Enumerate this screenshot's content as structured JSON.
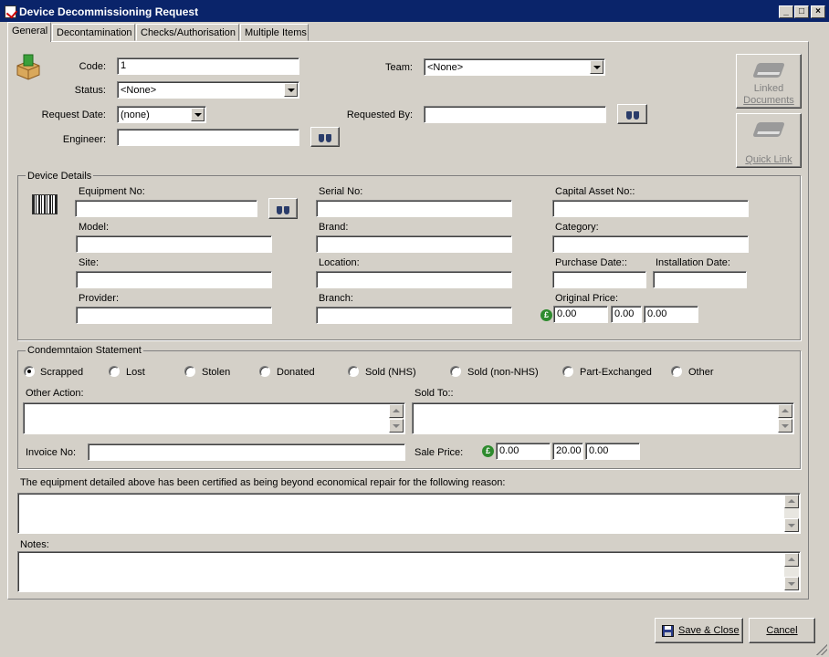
{
  "window": {
    "title": "Device Decommissioning Request"
  },
  "tabs": [
    {
      "label": "General"
    },
    {
      "label": "Decontamination"
    },
    {
      "label": "Checks/Authorisation"
    },
    {
      "label": "Multiple Items"
    }
  ],
  "header": {
    "code_label": "Code:",
    "code_value": "1",
    "status_label": "Status:",
    "status_value": "<None>",
    "request_date_label": "Request Date:",
    "request_date_value": "(none)",
    "engineer_label": "Engineer:",
    "engineer_value": "",
    "team_label": "Team:",
    "team_value": "<None>",
    "requested_by_label": "Requested By:",
    "requested_by_value": ""
  },
  "side_buttons": {
    "linked_documents_line1": "Linked",
    "linked_documents_line2": "Documents",
    "quick_link": "Quick Link"
  },
  "device_details": {
    "title": "Device Details",
    "equipment_no_label": "Equipment No:",
    "serial_no_label": "Serial No:",
    "capital_asset_no_label": "Capital Asset No::",
    "model_label": "Model:",
    "brand_label": "Brand:",
    "category_label": "Category:",
    "site_label": "Site:",
    "location_label": "Location:",
    "purchase_date_label": "Purchase Date::",
    "installation_date_label": "Installation Date:",
    "provider_label": "Provider:",
    "branch_label": "Branch:",
    "original_price_label": "Original Price:",
    "currency_symbol": "£",
    "original_price_values": [
      "0.00",
      "0.00",
      "0.00"
    ]
  },
  "condemnation": {
    "title": "Condemntaion Statement",
    "options": [
      "Scrapped",
      "Lost",
      "Stolen",
      "Donated",
      "Sold (NHS)",
      "Sold (non-NHS)",
      "Part-Exchanged",
      "Other"
    ],
    "selected": "Scrapped",
    "other_action_label": "Other Action:",
    "sold_to_label": "Sold To::",
    "invoice_no_label": "Invoice No:",
    "sale_price_label": "Sale Price:",
    "sale_price_values": [
      "0.00",
      "20.00",
      "0.00"
    ]
  },
  "reason_label": "The equipment detailed above has been certified as being beyond economical repair for the following reason:",
  "notes_label": "Notes:",
  "footer": {
    "save_close": "Save & Close",
    "cancel": "Cancel"
  }
}
